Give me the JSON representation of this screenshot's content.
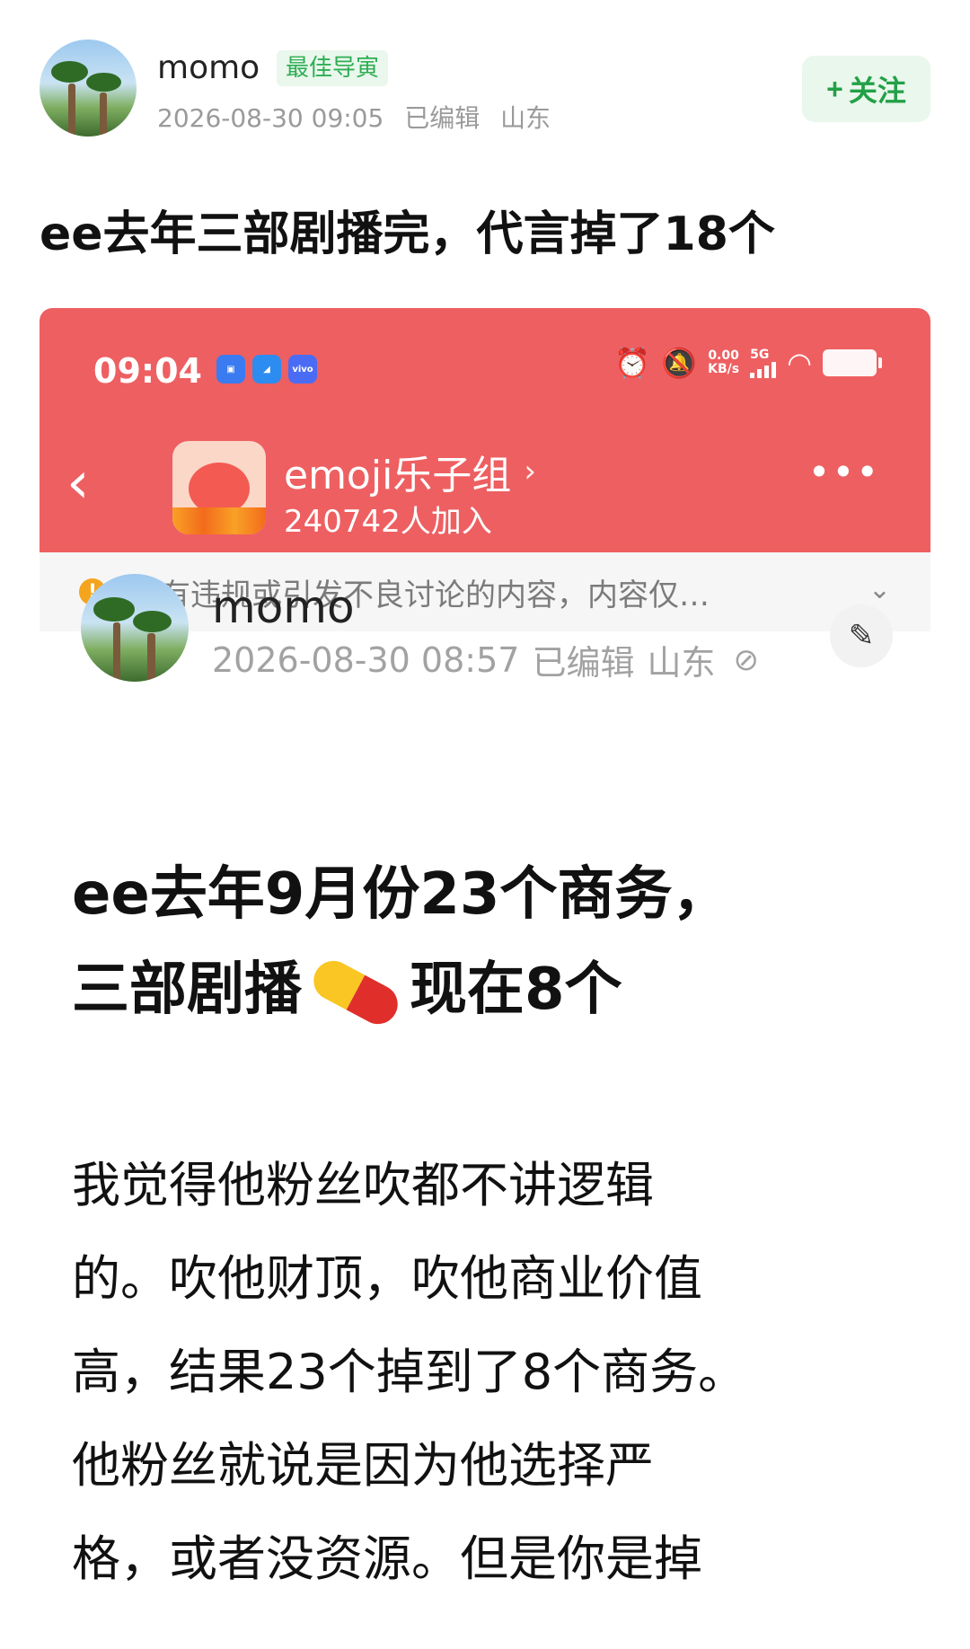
{
  "post": {
    "username": "momo",
    "badge": "最佳导寅",
    "date": "2026-08-30 09:05",
    "edited": "已编辑",
    "location": "山东",
    "follow_label": "关注",
    "follow_icon": "+",
    "title": "ee去年三部剧播完，代言掉了18个"
  },
  "embedded": {
    "status_bar": {
      "time": "09:04",
      "net_speed_value": "0.00",
      "net_speed_unit": "KB/s",
      "network": "5G",
      "app_icons": [
        "app-icon-1",
        "app-icon-2",
        "vivo-icon"
      ]
    },
    "group": {
      "name": "emoji乐子组",
      "members": "240742人加入"
    },
    "warning": "含有违规或引发不良讨论的内容，内容仅…",
    "inner_post": {
      "username": "momo",
      "date": "2026-08-30 08:57",
      "edited": "已编辑",
      "location": "山东",
      "title_line1": "ee去年9月份23个商务，",
      "title_line2_a": "三部剧播",
      "title_line2_b": "现在8个",
      "body_lines": [
        "我觉得他粉丝吹都不讲逻辑",
        "的。吹他财顶，吹他商业价值",
        "高，结果23个掉到了8个商务。",
        "他粉丝就说是因为他选择严",
        "格，或者没资源。但是你是掉"
      ]
    }
  },
  "colors": {
    "header_red": "#ee5f61",
    "follow_green": "#23a047",
    "badge_green": "#2fae54",
    "warning_orange": "#f4a51d"
  }
}
